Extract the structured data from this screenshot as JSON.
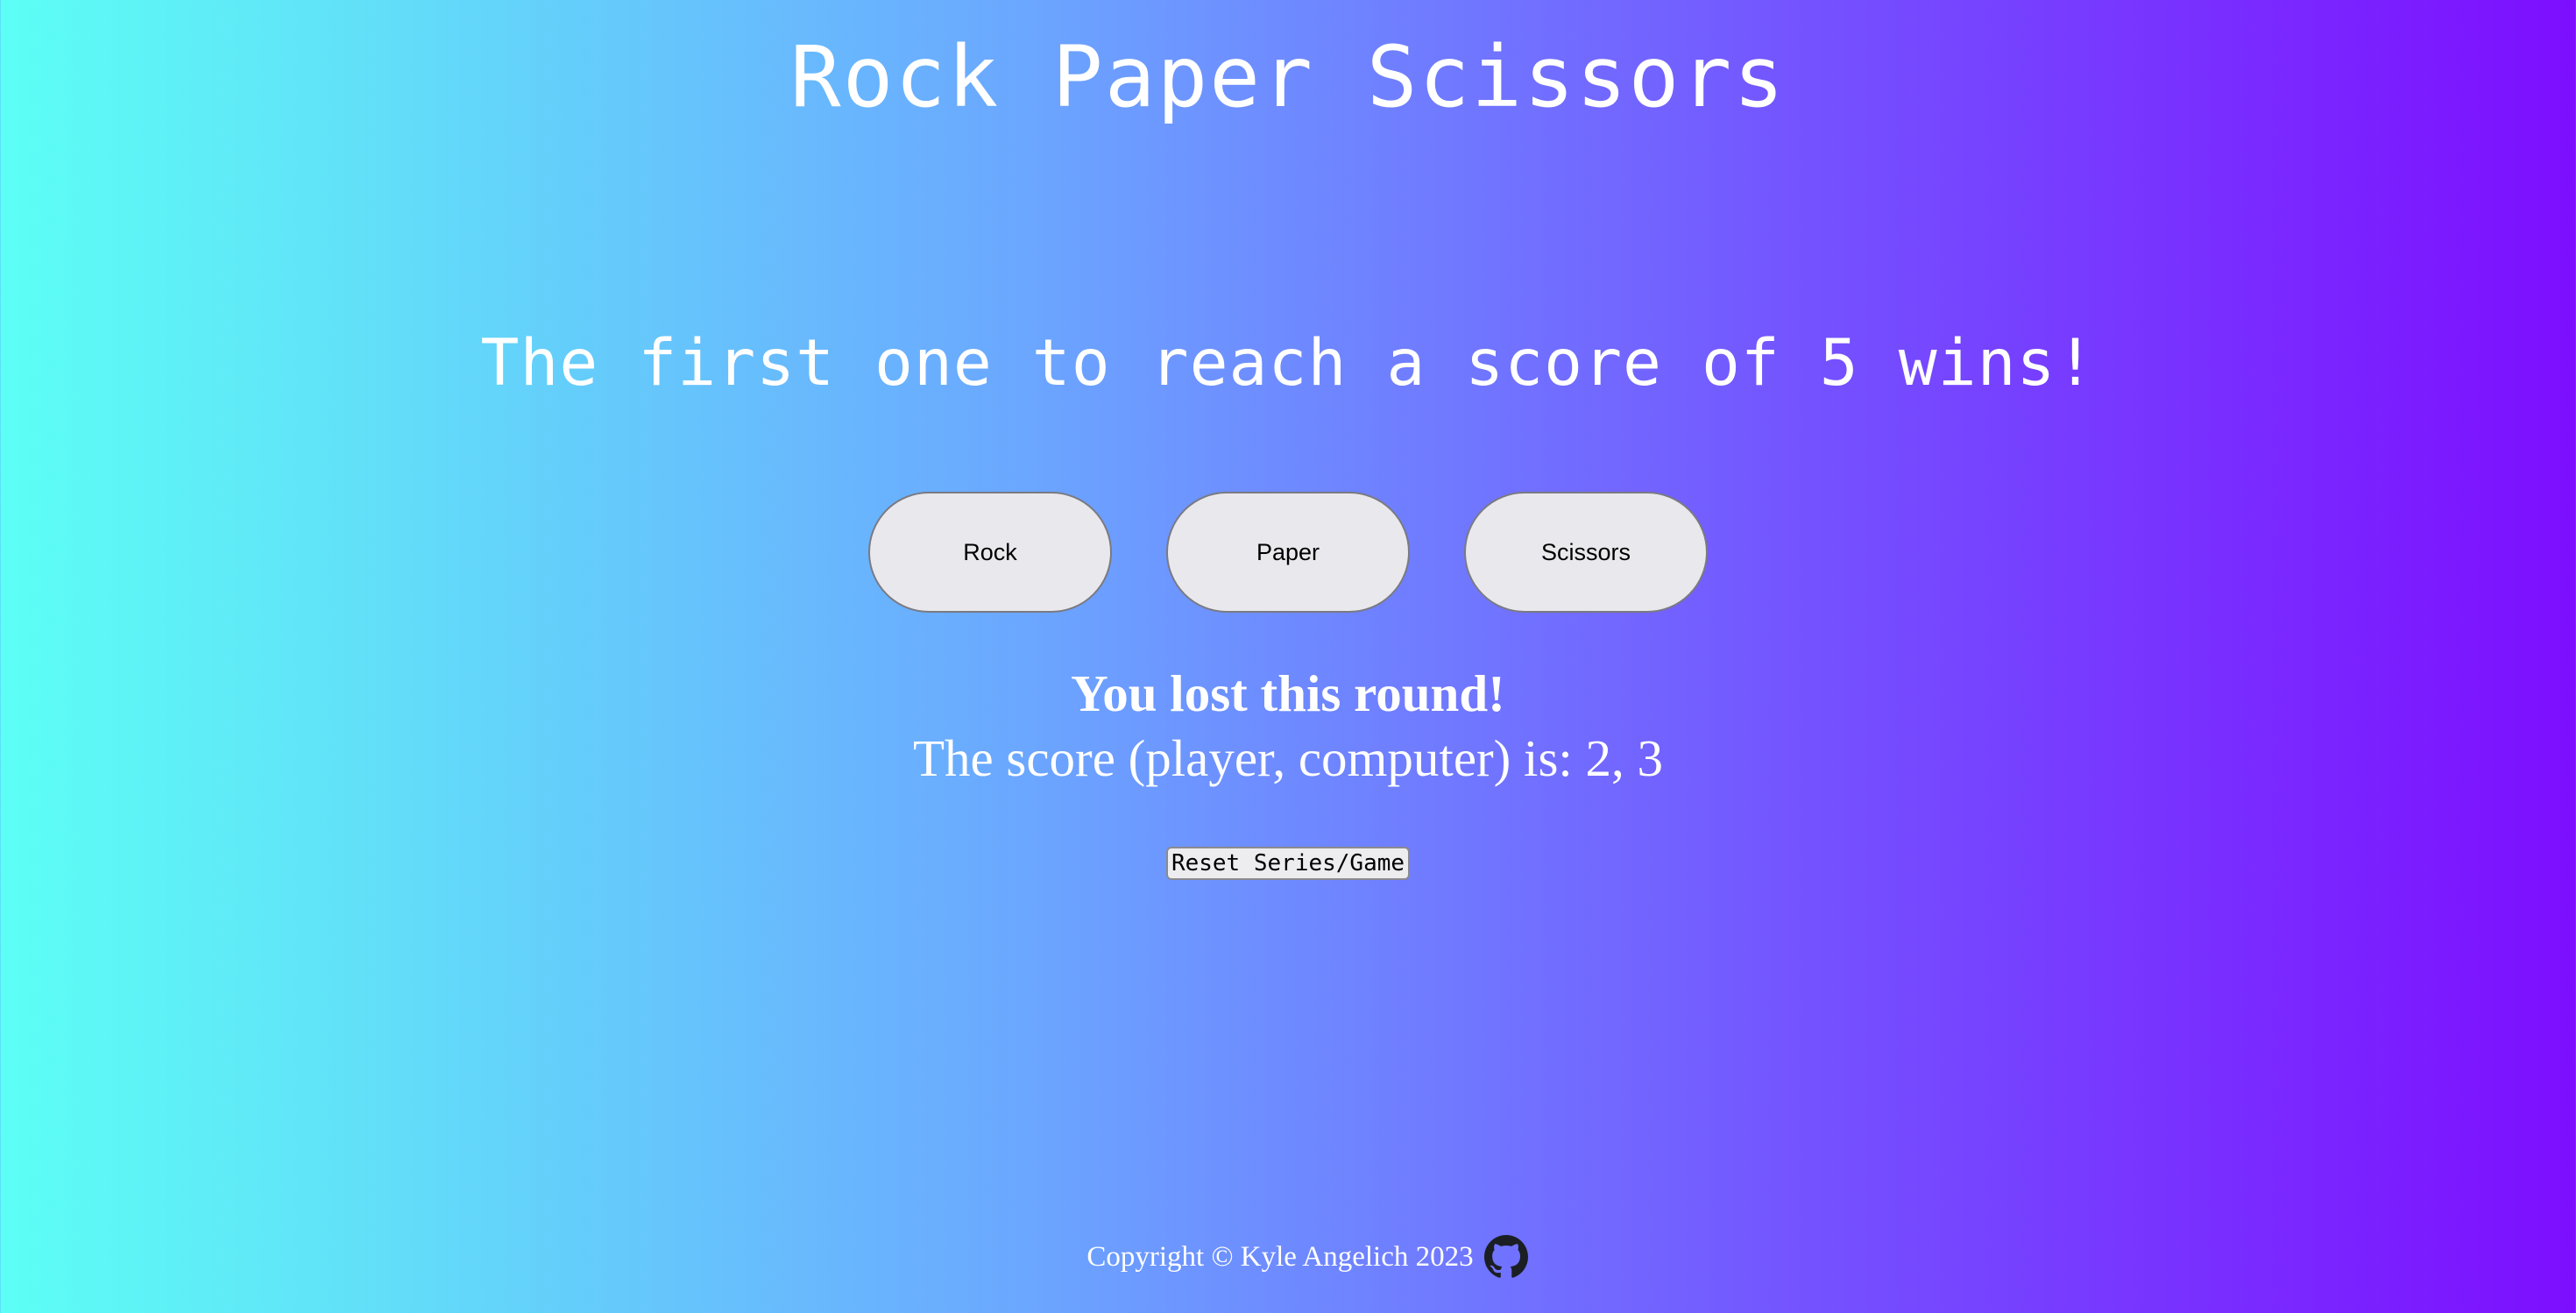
{
  "page": {
    "title": "Rock Paper Scissors",
    "subtitle": "The first one to reach a score of 5 wins!"
  },
  "choices": [
    {
      "label": "Rock"
    },
    {
      "label": "Paper"
    },
    {
      "label": "Scissors"
    }
  ],
  "status": {
    "result": "You lost this round!",
    "score": "The score (player, computer) is: 2, 3"
  },
  "controls": {
    "reset_label": "Reset Series/Game"
  },
  "footer": {
    "copyright": "Copyright © Kyle Angelich 2023",
    "icon": "github-icon"
  },
  "colors": {
    "gradient_start": "#5cfff5",
    "gradient_end": "#7d0eff",
    "text": "#ffffff",
    "button_bg": "#e9e8ec"
  }
}
